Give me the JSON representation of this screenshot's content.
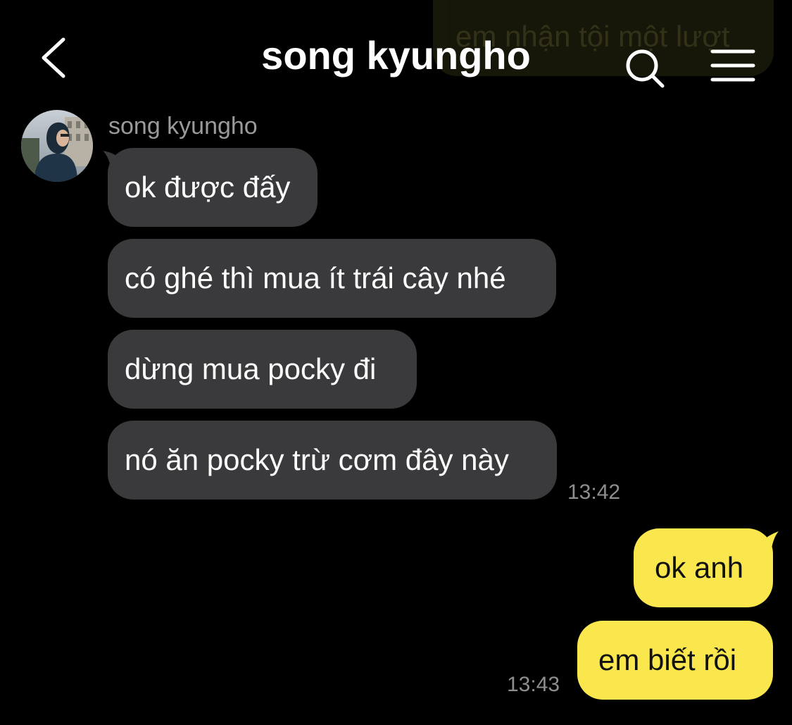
{
  "header": {
    "title": "song kyungho",
    "back_icon": "chevron-left-icon",
    "search_icon": "search-icon",
    "menu_icon": "hamburger-menu-icon"
  },
  "background_message": {
    "text": "em nhận tội một lượt"
  },
  "incoming": {
    "sender_name": "song kyungho",
    "messages": [
      "ok được đấy",
      "có ghé thì mua ít trái cây nhé",
      "dừng mua pocky đi",
      "nó ăn pocky trừ cơm đây này"
    ],
    "time": "13:42"
  },
  "outgoing": {
    "messages": [
      "ok anh",
      "em biết rồi"
    ],
    "time": "13:43"
  },
  "colors": {
    "background": "#000000",
    "incoming_bubble": "#3a3a3c",
    "outgoing_bubble": "#fae64d",
    "timestamp": "#8e8e8e"
  }
}
